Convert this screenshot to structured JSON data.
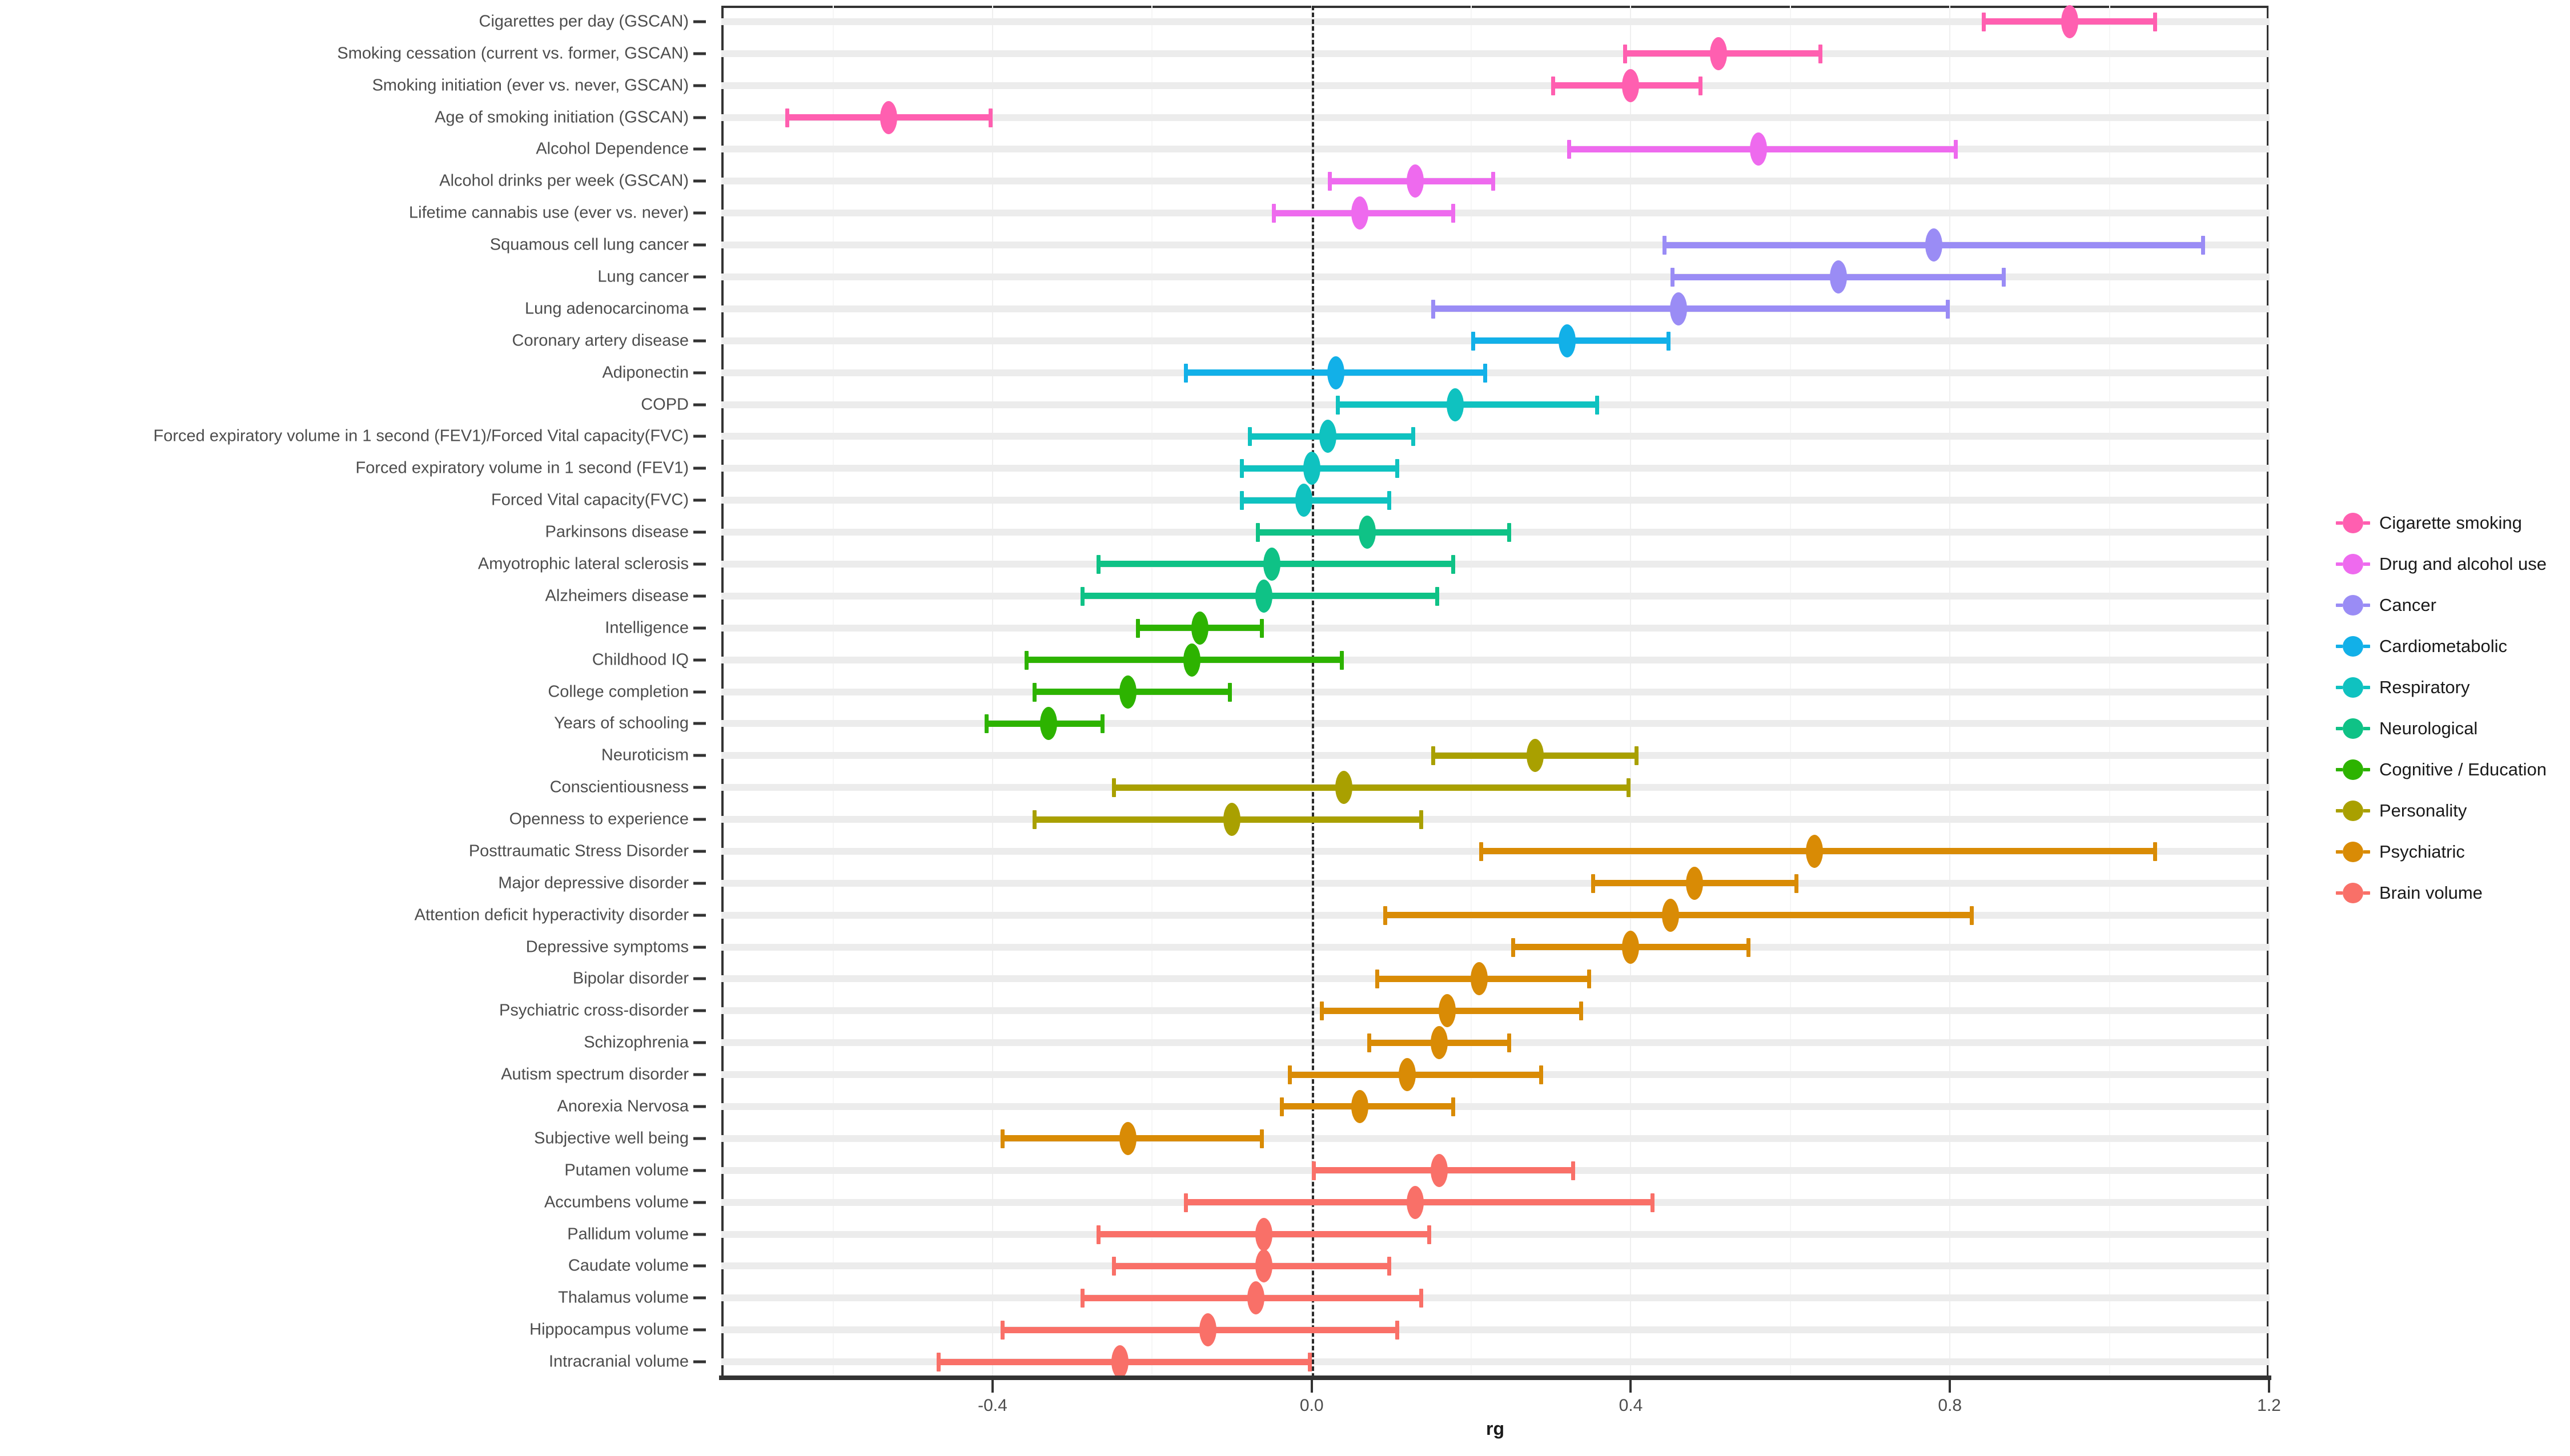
{
  "chart_data": {
    "type": "scatter",
    "title": "",
    "xlabel": "rg",
    "ylabel": "",
    "xlim": [
      -0.74,
      1.2
    ],
    "xticks": [
      -0.4,
      0.0,
      0.4,
      0.8,
      1.2
    ],
    "xticklabels": [
      "-0.4",
      "0.0",
      "0.4",
      "0.8",
      "1.2"
    ],
    "grid": true,
    "legend_position": "right",
    "reference_line": 0.0,
    "categories_axis": "y",
    "legend": [
      {
        "label": "Cigarette smoking",
        "color": "#FF5FB0"
      },
      {
        "label": "Drug and alcohol use",
        "color": "#EE6AEE"
      },
      {
        "label": "Cancer",
        "color": "#9A8CF5"
      },
      {
        "label": "Cardiometabolic",
        "color": "#12B0E8"
      },
      {
        "label": "Respiratory",
        "color": "#0FC2C0"
      },
      {
        "label": "Neurological",
        "color": "#0FC286"
      },
      {
        "label": "Cognitive / Education",
        "color": "#2DB300"
      },
      {
        "label": "Personality",
        "color": "#A9A000"
      },
      {
        "label": "Psychiatric",
        "color": "#D98B05"
      },
      {
        "label": "Brain volume",
        "color": "#F97068"
      }
    ],
    "points": [
      {
        "label": "Cigarettes per day (GSCAN)",
        "rg": 0.95,
        "lo": 0.84,
        "hi": 1.06,
        "group": "Cigarette smoking",
        "color": "#FF5FB0"
      },
      {
        "label": "Smoking cessation (current vs. former, GSCAN)",
        "rg": 0.51,
        "lo": 0.39,
        "hi": 0.64,
        "group": "Cigarette smoking",
        "color": "#FF5FB0"
      },
      {
        "label": "Smoking initiation (ever vs. never, GSCAN)",
        "rg": 0.4,
        "lo": 0.3,
        "hi": 0.49,
        "group": "Cigarette smoking",
        "color": "#FF5FB0"
      },
      {
        "label": "Age of smoking initiation (GSCAN)",
        "rg": -0.53,
        "lo": -0.66,
        "hi": -0.4,
        "group": "Cigarette smoking",
        "color": "#FF5FB0"
      },
      {
        "label": "Alcohol Dependence",
        "rg": 0.56,
        "lo": 0.32,
        "hi": 0.81,
        "group": "Drug and alcohol use",
        "color": "#EE6AEE"
      },
      {
        "label": "Alcohol drinks per week (GSCAN)",
        "rg": 0.13,
        "lo": 0.02,
        "hi": 0.23,
        "group": "Drug and alcohol use",
        "color": "#EE6AEE"
      },
      {
        "label": "Lifetime cannabis use (ever vs. never)",
        "rg": 0.06,
        "lo": -0.05,
        "hi": 0.18,
        "group": "Drug and alcohol use",
        "color": "#EE6AEE"
      },
      {
        "label": "Squamous cell lung cancer",
        "rg": 0.78,
        "lo": 0.44,
        "hi": 1.12,
        "group": "Cancer",
        "color": "#9A8CF5"
      },
      {
        "label": "Lung cancer",
        "rg": 0.66,
        "lo": 0.45,
        "hi": 0.87,
        "group": "Cancer",
        "color": "#9A8CF5"
      },
      {
        "label": "Lung adenocarcinoma",
        "rg": 0.46,
        "lo": 0.15,
        "hi": 0.8,
        "group": "Cancer",
        "color": "#9A8CF5"
      },
      {
        "label": "Coronary artery disease",
        "rg": 0.32,
        "lo": 0.2,
        "hi": 0.45,
        "group": "Cardiometabolic",
        "color": "#12B0E8"
      },
      {
        "label": "Adiponectin",
        "rg": 0.03,
        "lo": -0.16,
        "hi": 0.22,
        "group": "Cardiometabolic",
        "color": "#12B0E8"
      },
      {
        "label": "COPD",
        "rg": 0.18,
        "lo": 0.03,
        "hi": 0.36,
        "group": "Respiratory",
        "color": "#0FC2C0"
      },
      {
        "label": "Forced expiratory volume in 1 second (FEV1)/Forced Vital capacity(FVC)",
        "rg": 0.02,
        "lo": -0.08,
        "hi": 0.13,
        "group": "Respiratory",
        "color": "#0FC2C0"
      },
      {
        "label": "Forced expiratory volume in 1 second (FEV1)",
        "rg": 0.0,
        "lo": -0.09,
        "hi": 0.11,
        "group": "Respiratory",
        "color": "#0FC2C0"
      },
      {
        "label": "Forced Vital capacity(FVC)",
        "rg": -0.01,
        "lo": -0.09,
        "hi": 0.1,
        "group": "Respiratory",
        "color": "#0FC2C0"
      },
      {
        "label": "Parkinsons disease",
        "rg": 0.07,
        "lo": -0.07,
        "hi": 0.25,
        "group": "Neurological",
        "color": "#0FC286"
      },
      {
        "label": "Amyotrophic lateral sclerosis",
        "rg": -0.05,
        "lo": -0.27,
        "hi": 0.18,
        "group": "Neurological",
        "color": "#0FC286"
      },
      {
        "label": "Alzheimers disease",
        "rg": -0.06,
        "lo": -0.29,
        "hi": 0.16,
        "group": "Neurological",
        "color": "#0FC286"
      },
      {
        "label": "Intelligence",
        "rg": -0.14,
        "lo": -0.22,
        "hi": -0.06,
        "group": "Cognitive / Education",
        "color": "#2DB300"
      },
      {
        "label": "Childhood IQ",
        "rg": -0.15,
        "lo": -0.36,
        "hi": 0.04,
        "group": "Cognitive / Education",
        "color": "#2DB300"
      },
      {
        "label": "College completion",
        "rg": -0.23,
        "lo": -0.35,
        "hi": -0.1,
        "group": "Cognitive / Education",
        "color": "#2DB300"
      },
      {
        "label": "Years of schooling",
        "rg": -0.33,
        "lo": -0.41,
        "hi": -0.26,
        "group": "Cognitive / Education",
        "color": "#2DB300"
      },
      {
        "label": "Neuroticism",
        "rg": 0.28,
        "lo": 0.15,
        "hi": 0.41,
        "group": "Personality",
        "color": "#A9A000"
      },
      {
        "label": "Conscientiousness",
        "rg": 0.04,
        "lo": -0.25,
        "hi": 0.4,
        "group": "Personality",
        "color": "#A9A000"
      },
      {
        "label": "Openness to experience",
        "rg": -0.1,
        "lo": -0.35,
        "hi": 0.14,
        "group": "Personality",
        "color": "#A9A000"
      },
      {
        "label": "Posttraumatic Stress Disorder",
        "rg": 0.63,
        "lo": 0.21,
        "hi": 1.06,
        "group": "Psychiatric",
        "color": "#D98B05"
      },
      {
        "label": "Major depressive disorder",
        "rg": 0.48,
        "lo": 0.35,
        "hi": 0.61,
        "group": "Psychiatric",
        "color": "#D98B05"
      },
      {
        "label": "Attention deficit hyperactivity disorder",
        "rg": 0.45,
        "lo": 0.09,
        "hi": 0.83,
        "group": "Psychiatric",
        "color": "#D98B05"
      },
      {
        "label": "Depressive symptoms",
        "rg": 0.4,
        "lo": 0.25,
        "hi": 0.55,
        "group": "Psychiatric",
        "color": "#D98B05"
      },
      {
        "label": "Bipolar disorder",
        "rg": 0.21,
        "lo": 0.08,
        "hi": 0.35,
        "group": "Psychiatric",
        "color": "#D98B05"
      },
      {
        "label": "Psychiatric cross-disorder",
        "rg": 0.17,
        "lo": 0.01,
        "hi": 0.34,
        "group": "Psychiatric",
        "color": "#D98B05"
      },
      {
        "label": "Schizophrenia",
        "rg": 0.16,
        "lo": 0.07,
        "hi": 0.25,
        "group": "Psychiatric",
        "color": "#D98B05"
      },
      {
        "label": "Autism spectrum disorder",
        "rg": 0.12,
        "lo": -0.03,
        "hi": 0.29,
        "group": "Psychiatric",
        "color": "#D98B05"
      },
      {
        "label": "Anorexia Nervosa",
        "rg": 0.06,
        "lo": -0.04,
        "hi": 0.18,
        "group": "Psychiatric",
        "color": "#D98B05"
      },
      {
        "label": "Subjective well being",
        "rg": -0.23,
        "lo": -0.39,
        "hi": -0.06,
        "group": "Psychiatric",
        "color": "#D98B05"
      },
      {
        "label": "Putamen volume",
        "rg": 0.16,
        "lo": 0.0,
        "hi": 0.33,
        "group": "Brain volume",
        "color": "#F97068"
      },
      {
        "label": "Accumbens volume",
        "rg": 0.13,
        "lo": -0.16,
        "hi": 0.43,
        "group": "Brain volume",
        "color": "#F97068"
      },
      {
        "label": "Pallidum volume",
        "rg": -0.06,
        "lo": -0.27,
        "hi": 0.15,
        "group": "Brain volume",
        "color": "#F97068"
      },
      {
        "label": "Caudate volume",
        "rg": -0.06,
        "lo": -0.25,
        "hi": 0.1,
        "group": "Brain volume",
        "color": "#F97068"
      },
      {
        "label": "Thalamus volume",
        "rg": -0.07,
        "lo": -0.29,
        "hi": 0.14,
        "group": "Brain volume",
        "color": "#F97068"
      },
      {
        "label": "Hippocampus volume",
        "rg": -0.13,
        "lo": -0.39,
        "hi": 0.11,
        "group": "Brain volume",
        "color": "#F97068"
      },
      {
        "label": "Intracranial volume",
        "rg": -0.24,
        "lo": -0.47,
        "hi": 0.0,
        "group": "Brain volume",
        "color": "#F97068"
      }
    ]
  }
}
